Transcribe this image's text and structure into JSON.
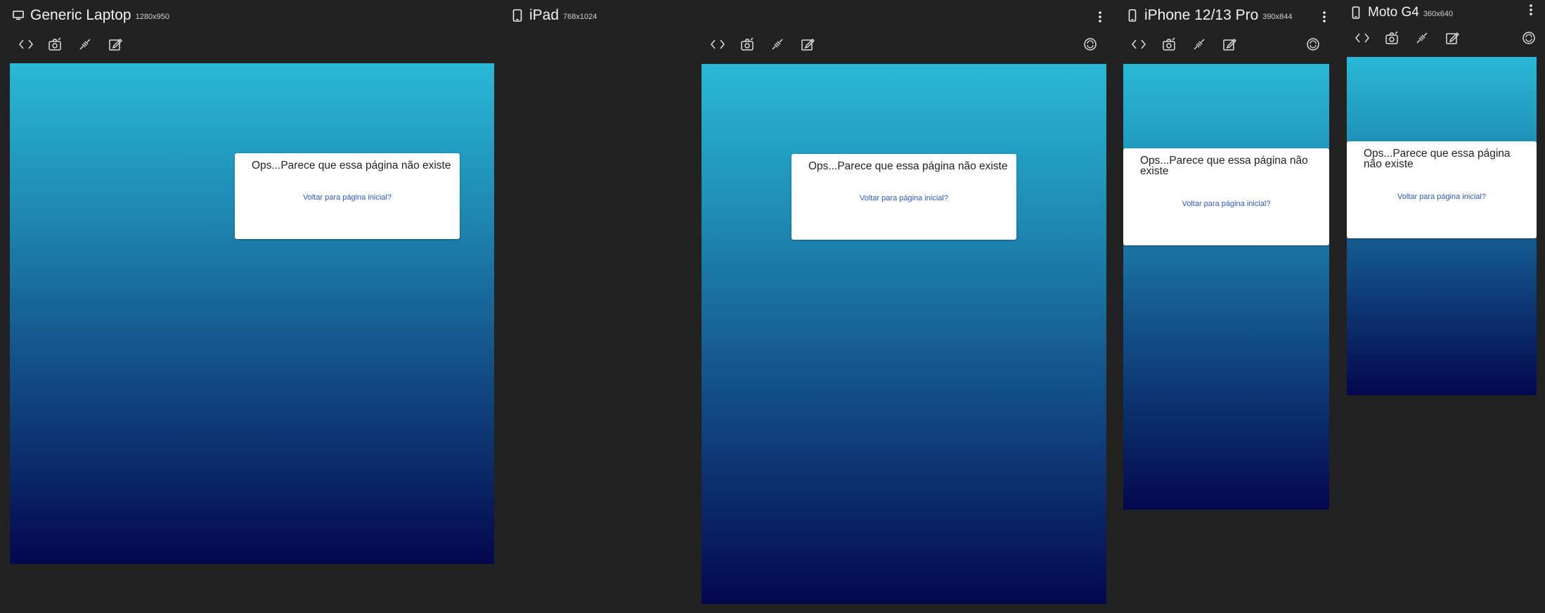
{
  "devices": [
    {
      "name": "Generic Laptop",
      "resolution": "1280x950",
      "icon": "laptop-icon"
    },
    {
      "name": "iPad",
      "resolution": "768x1024",
      "icon": "tablet-icon"
    },
    {
      "name": "iPhone 12/13 Pro",
      "resolution": "390x844",
      "icon": "phone-icon"
    },
    {
      "name": "Moto G4",
      "resolution": "360x640",
      "icon": "phone-icon"
    }
  ],
  "toolbar_icons": [
    "code-icon",
    "screenshot-icon",
    "disconnect-icon",
    "edit-icon",
    "rotate-icon"
  ],
  "page": {
    "message": "Ops...Parece que essa página não existe",
    "link": "Voltar para página inicial?"
  },
  "colors": {
    "panel_bg": "#222222",
    "gradient_top": "#29b8d8",
    "gradient_bottom": "#04074e",
    "link": "#2f56c8"
  }
}
